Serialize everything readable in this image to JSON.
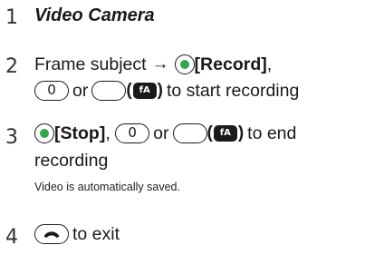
{
  "steps": [
    {
      "number": "1",
      "title": "Video Camera"
    },
    {
      "number": "2",
      "line1_text": "Frame subject",
      "arrow": "→",
      "line1_key_label": "[Record]",
      "line1_suffix": ",",
      "line2_zero_key": "0",
      "line2_or": "or",
      "paren_open": "(",
      "icon_label": "fA",
      "paren_close": ")",
      "line2_text": "to start recording"
    },
    {
      "number": "3",
      "line1_key_label": "[Stop]",
      "line1_after": ", ",
      "line1_zero_key": "0",
      "line1_or": "or",
      "paren_open": "(",
      "icon_label": "fA",
      "paren_close": ")",
      "line1_text": "to end",
      "line2_text": "recording",
      "note": "Video is automatically saved."
    },
    {
      "number": "4",
      "text": "to exit"
    }
  ],
  "icons": {
    "center_key": "center-select-key-icon",
    "end_key": "end-call-key-icon",
    "fa_key": "fa-key-icon"
  },
  "colors": {
    "center_key_dot": "#2ea84a",
    "text": "#1a1a1a"
  }
}
